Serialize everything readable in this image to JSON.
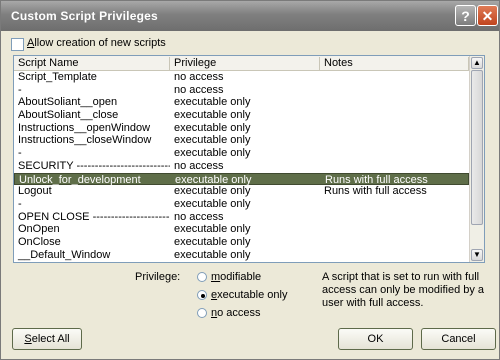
{
  "window": {
    "title": "Custom Script Privileges",
    "help": "?",
    "close": "✕"
  },
  "allow": {
    "label_u": "A",
    "label_rest": "llow creation of new scripts",
    "checked": false
  },
  "list": {
    "headers": [
      "Script Name",
      "Privilege",
      "Notes"
    ],
    "rows": [
      {
        "name": "Script_Template",
        "priv": "no access",
        "notes": ""
      },
      {
        "name": "-",
        "priv": "no access",
        "notes": ""
      },
      {
        "name": "AboutSoliant__open",
        "priv": "executable only",
        "notes": ""
      },
      {
        "name": "AboutSoliant__close",
        "priv": "executable only",
        "notes": ""
      },
      {
        "name": "Instructions__openWindow",
        "priv": "executable only",
        "notes": ""
      },
      {
        "name": "Instructions__closeWindow",
        "priv": "executable only",
        "notes": ""
      },
      {
        "name": "-",
        "priv": "executable only",
        "notes": ""
      },
      {
        "name": "SECURITY -----------------------------",
        "priv": "no access",
        "notes": ""
      },
      {
        "name": "Unlock_for_development",
        "priv": "executable only",
        "notes": "Runs with full access",
        "selected": true
      },
      {
        "name": "Logout",
        "priv": "executable only",
        "notes": "Runs with full access"
      },
      {
        "name": "-",
        "priv": "executable only",
        "notes": ""
      },
      {
        "name": "OPEN CLOSE -----------------------",
        "priv": "no access",
        "notes": ""
      },
      {
        "name": "OnOpen",
        "priv": "executable only",
        "notes": ""
      },
      {
        "name": "OnClose",
        "priv": "executable only",
        "notes": ""
      },
      {
        "name": "__Default_Window",
        "priv": "executable only",
        "notes": ""
      }
    ]
  },
  "privilege": {
    "label": "Privilege:",
    "options": [
      {
        "u": "m",
        "rest": "odifiable",
        "selected": false
      },
      {
        "u": "e",
        "rest": "xecutable only",
        "selected": true
      },
      {
        "u": "n",
        "rest": "o access",
        "selected": false
      }
    ],
    "note": "A script that is set to run with full access can only be modified by a user with full access."
  },
  "buttons": {
    "select_all_u": "S",
    "select_all_rest": "elect All",
    "ok": "OK",
    "cancel": "Cancel"
  }
}
